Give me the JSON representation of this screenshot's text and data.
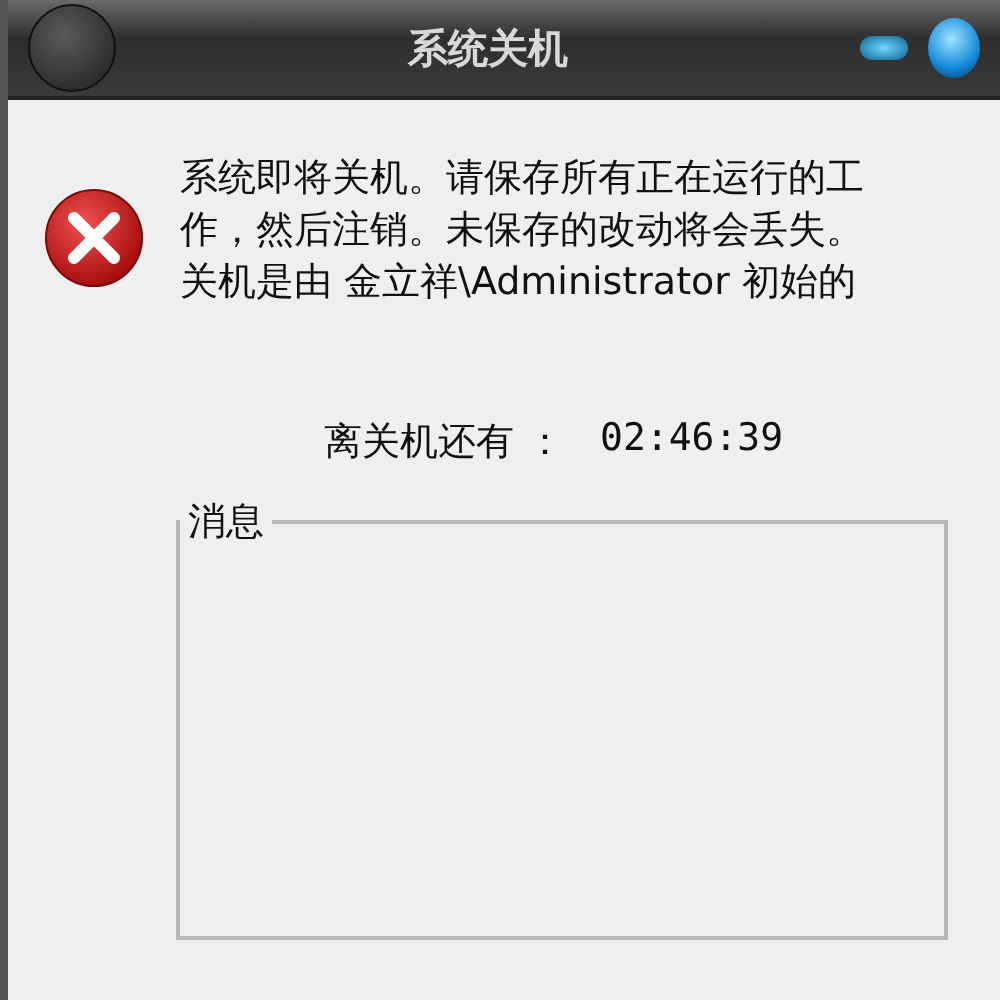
{
  "window": {
    "title": "系统关机"
  },
  "message": {
    "lines": [
      "系统即将关机。请保存所有正在运行的工",
      "作，然后注销。未保存的改动将会丢失。",
      "关机是由 金立祥\\Administrator 初始的"
    ]
  },
  "countdown": {
    "label": "离关机还有 ：",
    "value": "02:46:39"
  },
  "message_group": {
    "legend": "消息"
  }
}
